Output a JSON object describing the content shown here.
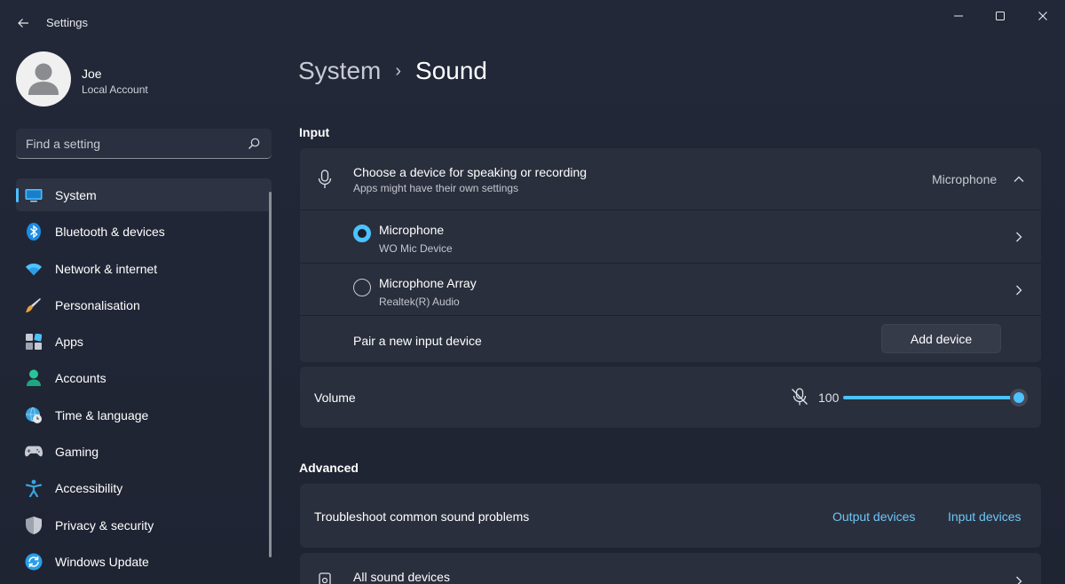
{
  "app": {
    "title": "Settings"
  },
  "user": {
    "name": "Joe",
    "account_type": "Local Account"
  },
  "search": {
    "placeholder": "Find a setting"
  },
  "sidebar": {
    "items": [
      {
        "label": "System",
        "icon": "system-icon",
        "active": true
      },
      {
        "label": "Bluetooth & devices",
        "icon": "bluetooth-icon"
      },
      {
        "label": "Network & internet",
        "icon": "wifi-icon"
      },
      {
        "label": "Personalisation",
        "icon": "brush-icon"
      },
      {
        "label": "Apps",
        "icon": "apps-icon"
      },
      {
        "label": "Accounts",
        "icon": "accounts-icon"
      },
      {
        "label": "Time & language",
        "icon": "globe-clock-icon"
      },
      {
        "label": "Gaming",
        "icon": "gamepad-icon"
      },
      {
        "label": "Accessibility",
        "icon": "accessibility-icon"
      },
      {
        "label": "Privacy & security",
        "icon": "shield-icon"
      },
      {
        "label": "Windows Update",
        "icon": "update-icon"
      }
    ]
  },
  "breadcrumb": {
    "parent": "System",
    "separator": "›",
    "current": "Sound"
  },
  "input": {
    "section_title": "Input",
    "chooser": {
      "title": "Choose a device for speaking or recording",
      "subtitle": "Apps might have their own settings",
      "selected": "Microphone"
    },
    "devices": [
      {
        "name": "Microphone",
        "detail": "WO Mic Device",
        "selected": true
      },
      {
        "name": "Microphone Array",
        "detail": "Realtek(R) Audio",
        "selected": false
      }
    ],
    "pair": {
      "label": "Pair a new input device",
      "button": "Add device"
    },
    "volume": {
      "label": "Volume",
      "value": "100",
      "level": 100
    }
  },
  "advanced": {
    "section_title": "Advanced",
    "troubleshoot": {
      "label": "Troubleshoot common sound problems",
      "output_link": "Output devices",
      "input_link": "Input devices"
    },
    "all_devices": {
      "label": "All sound devices"
    }
  },
  "colors": {
    "accent": "#4cc2ff",
    "link": "#6cc6f6",
    "background": "#1f2433",
    "card": "#2a2f3d"
  }
}
